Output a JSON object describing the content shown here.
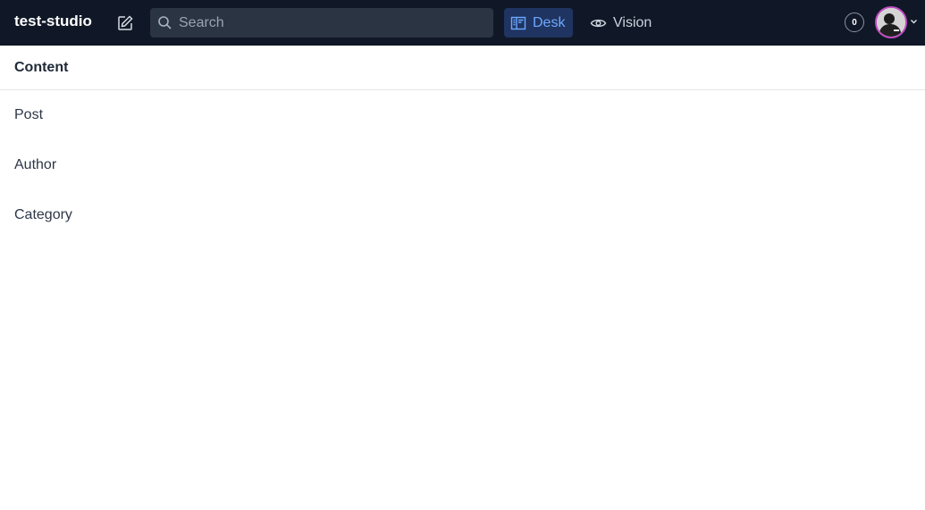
{
  "app": {
    "title": "test-studio"
  },
  "toolbar": {
    "compose_icon": "compose-icon",
    "search": {
      "placeholder": "Search",
      "value": ""
    },
    "tools": [
      {
        "label": "Desk",
        "icon": "desk-icon",
        "active": true
      },
      {
        "label": "Vision",
        "icon": "eye-icon",
        "active": false
      }
    ],
    "notifications": {
      "count": "0"
    },
    "user": {
      "avatar": "avatar",
      "menu_icon": "chevron-down-icon"
    }
  },
  "pane": {
    "title": "Content",
    "items": [
      {
        "label": "Post"
      },
      {
        "label": "Author"
      },
      {
        "label": "Category"
      }
    ]
  },
  "colors": {
    "topbar_bg": "#101827",
    "active_tool_bg": "#1f3460",
    "active_tool_text": "#6ea8ff",
    "avatar_ring": "#c34ac4"
  }
}
